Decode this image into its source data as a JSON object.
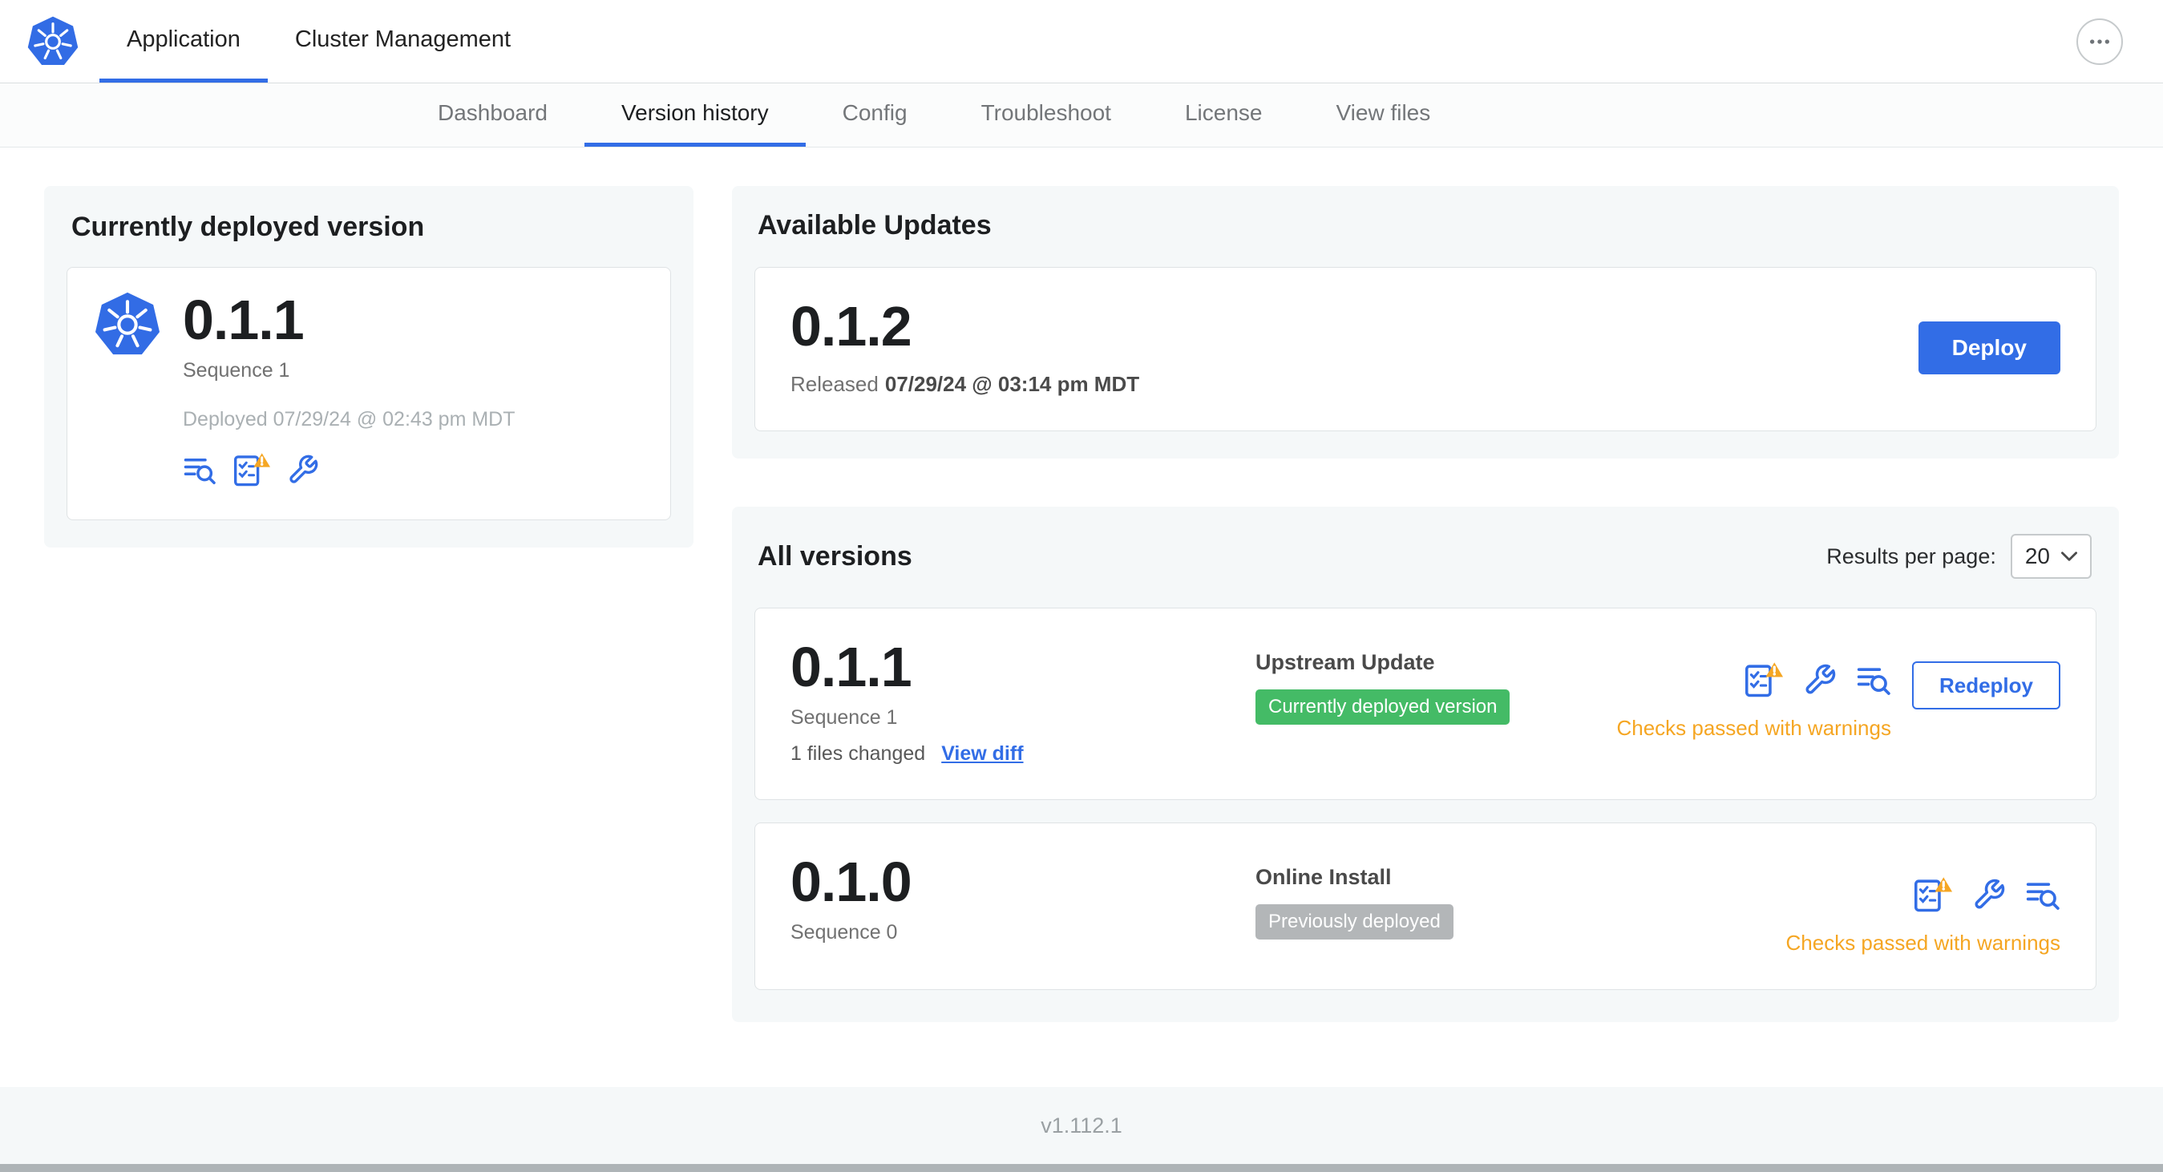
{
  "colors": {
    "accent": "#326de6",
    "success_badge": "#44bb66",
    "inactive_badge": "#b3b6b8",
    "warning_text": "#f5a623",
    "panel_bg": "#f5f8f9"
  },
  "icons": {
    "brand": "kubernetes-logo",
    "top_right": "ellipsis-menu-icon",
    "version_actions": [
      "diff-logs-icon",
      "preflight-checklist-warning-icon",
      "config-tools-icon"
    ],
    "select_caret": "chevron-down-icon"
  },
  "header": {
    "tabs": [
      {
        "label": "Application",
        "active": true
      },
      {
        "label": "Cluster Management",
        "active": false
      }
    ]
  },
  "subnav": {
    "tabs": [
      {
        "label": "Dashboard",
        "active": false
      },
      {
        "label": "Version history",
        "active": true
      },
      {
        "label": "Config",
        "active": false
      },
      {
        "label": "Troubleshoot",
        "active": false
      },
      {
        "label": "License",
        "active": false
      },
      {
        "label": "View files",
        "active": false
      }
    ]
  },
  "current_version": {
    "title": "Currently deployed version",
    "version": "0.1.1",
    "sequence": "Sequence 1",
    "deployed": "Deployed 07/29/24 @ 02:43 pm MDT"
  },
  "available_updates": {
    "title": "Available Updates",
    "version": "0.1.2",
    "released_label": "Released",
    "released_date": "07/29/24 @ 03:14 pm MDT",
    "deploy_label": "Deploy"
  },
  "all_versions": {
    "title": "All versions",
    "results_per_page_label": "Results per page:",
    "results_per_page_value": "20",
    "rows": [
      {
        "version": "0.1.1",
        "sequence": "Sequence 1",
        "files_changed": "1 files changed",
        "view_diff_label": "View diff",
        "source": "Upstream Update",
        "badge": "Currently deployed version",
        "badge_type": "green",
        "status": "Checks passed with warnings",
        "action_label": "Redeploy"
      },
      {
        "version": "0.1.0",
        "sequence": "Sequence 0",
        "source": "Online Install",
        "badge": "Previously deployed",
        "badge_type": "gray",
        "status": "Checks passed with warnings"
      }
    ]
  },
  "footer": {
    "app_version": "v1.112.1"
  }
}
